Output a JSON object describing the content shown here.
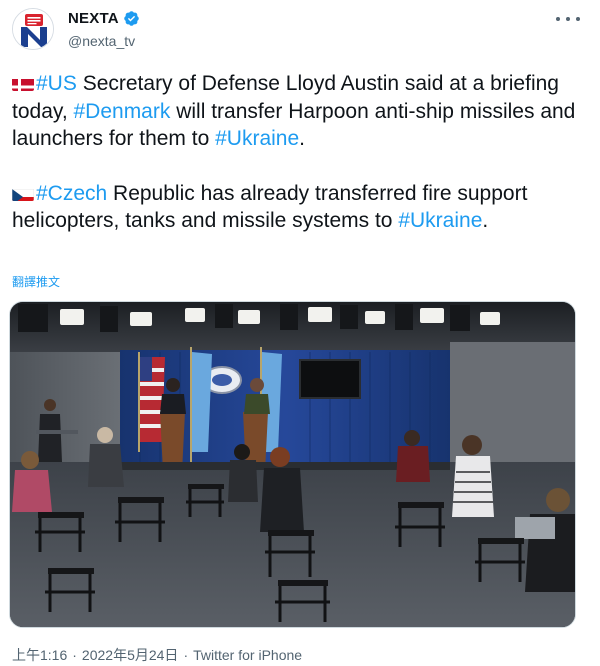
{
  "author": {
    "display_name": "NEXTA",
    "handle": "@nexta_tv",
    "verified": true,
    "avatar_letter": "N"
  },
  "tweet": {
    "para1": {
      "tag1": "#US",
      "text1": " Secretary of Defense Lloyd Austin said at a briefing today, ",
      "tag2": "#Denmark",
      "text2": " will transfer Harpoon anti-ship missiles and launchers for them to ",
      "tag3": "#Ukraine",
      "text3": "."
    },
    "para2": {
      "tag1": "#Czech",
      "text1": " Republic has already transferred fire support helicopters, tanks and missile systems to ",
      "tag2": "#Ukraine",
      "text2": "."
    },
    "translate_label": "翻譯推文"
  },
  "footer": {
    "time": "上午1:16",
    "date": "2022年5月24日",
    "separator": "·",
    "source": "Twitter for iPhone"
  },
  "colors": {
    "accent": "#1d9bf0",
    "avatar_red": "#d9232e",
    "avatar_navy": "#1b3f8f"
  }
}
